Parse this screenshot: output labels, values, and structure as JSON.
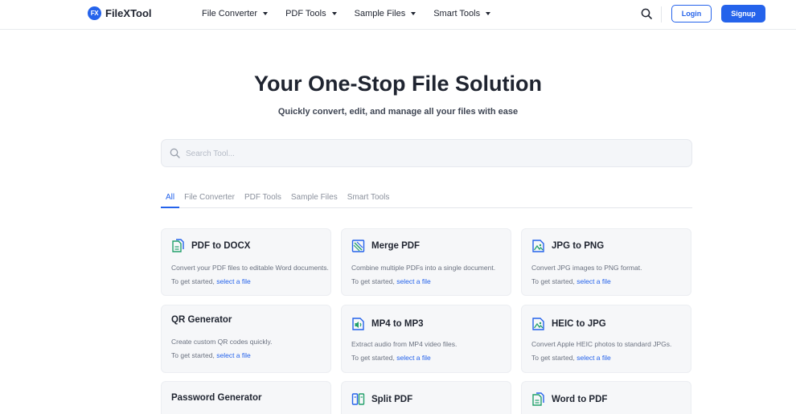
{
  "brand": {
    "logo_mark": "FX",
    "name": "FileXTool"
  },
  "nav": [
    {
      "label": "File Converter"
    },
    {
      "label": "PDF Tools"
    },
    {
      "label": "Sample Files"
    },
    {
      "label": "Smart Tools"
    }
  ],
  "header": {
    "login_label": "Login",
    "signup_label": "Signup"
  },
  "hero": {
    "title": "Your One-Stop File Solution",
    "subtitle": "Quickly convert, edit, and manage all your files with ease"
  },
  "search": {
    "placeholder": "Search Tool...",
    "value": ""
  },
  "tabs": [
    {
      "label": "All",
      "active": true
    },
    {
      "label": "File Converter",
      "active": false
    },
    {
      "label": "PDF Tools",
      "active": false
    },
    {
      "label": "Sample Files",
      "active": false
    },
    {
      "label": "Smart Tools",
      "active": false
    }
  ],
  "cta": {
    "prefix": "To get started, ",
    "link": "select a file"
  },
  "cards": [
    {
      "title": "PDF to DOCX",
      "description": "Convert your PDF files to editable Word documents.",
      "icon": "file-convert-icon"
    },
    {
      "title": "Merge PDF",
      "description": "Combine multiple PDFs into a single document.",
      "icon": "merge-icon"
    },
    {
      "title": "JPG to PNG",
      "description": "Convert JPG images to PNG format.",
      "icon": "image-convert-icon"
    },
    {
      "title": "QR Generator",
      "description": "Create custom QR codes quickly.",
      "icon": ""
    },
    {
      "title": "MP4 to MP3",
      "description": "Extract audio from MP4 video files.",
      "icon": "audio-file-icon"
    },
    {
      "title": "HEIC to JPG",
      "description": "Convert Apple HEIC photos to standard JPGs.",
      "icon": "image-convert-icon"
    },
    {
      "title": "Password Generator",
      "description": "",
      "icon": ""
    },
    {
      "title": "Split PDF",
      "description": "",
      "icon": "split-icon"
    },
    {
      "title": "Word to PDF",
      "description": "",
      "icon": "file-convert-icon"
    }
  ],
  "colors": {
    "accent": "#2563eb",
    "icon_green": "#22a06b",
    "text": "#1f2430",
    "muted": "#6b7280",
    "card_bg": "#f6f7f9"
  }
}
